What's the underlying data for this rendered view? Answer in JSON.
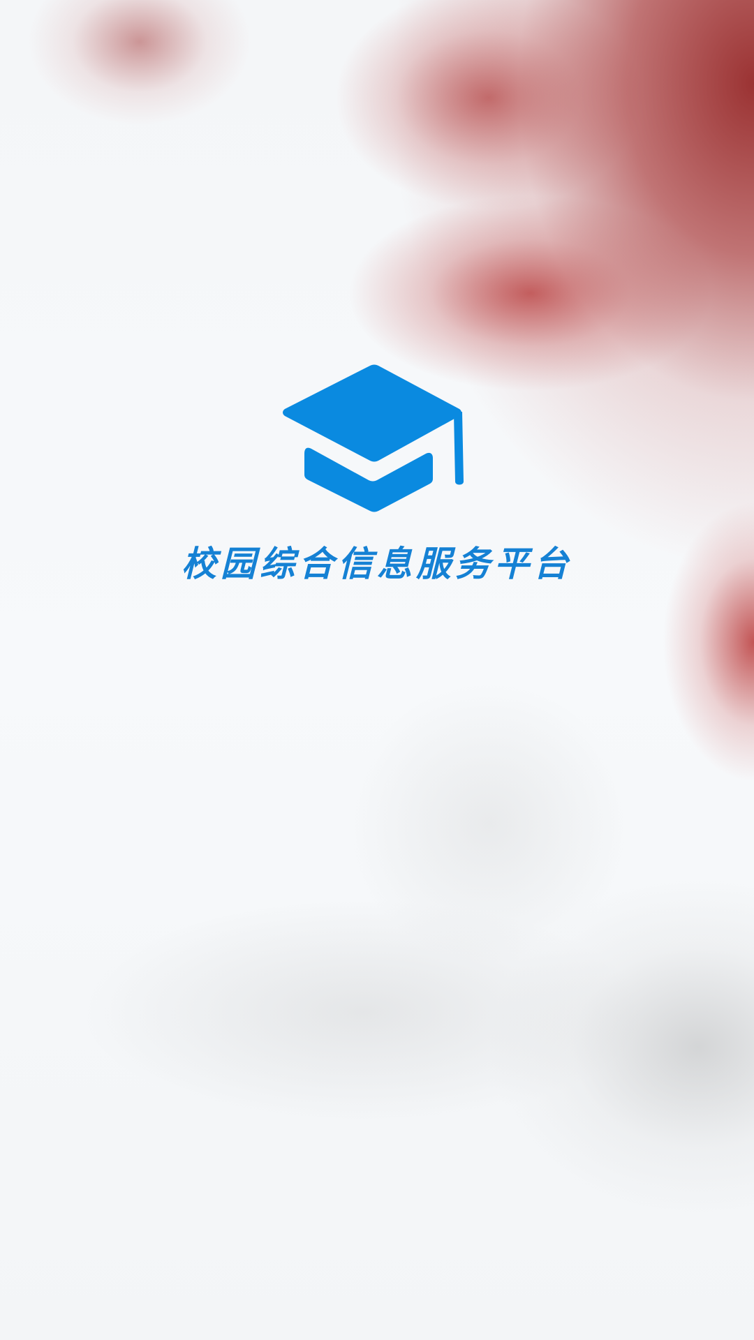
{
  "app": {
    "title": "校园综合信息服务平台",
    "logo_icon": "graduation-cap-icon",
    "brand_color": "#0a8ae0"
  },
  "background": {
    "description_colors": [
      "#a83c3c",
      "#f5f7f9"
    ]
  }
}
